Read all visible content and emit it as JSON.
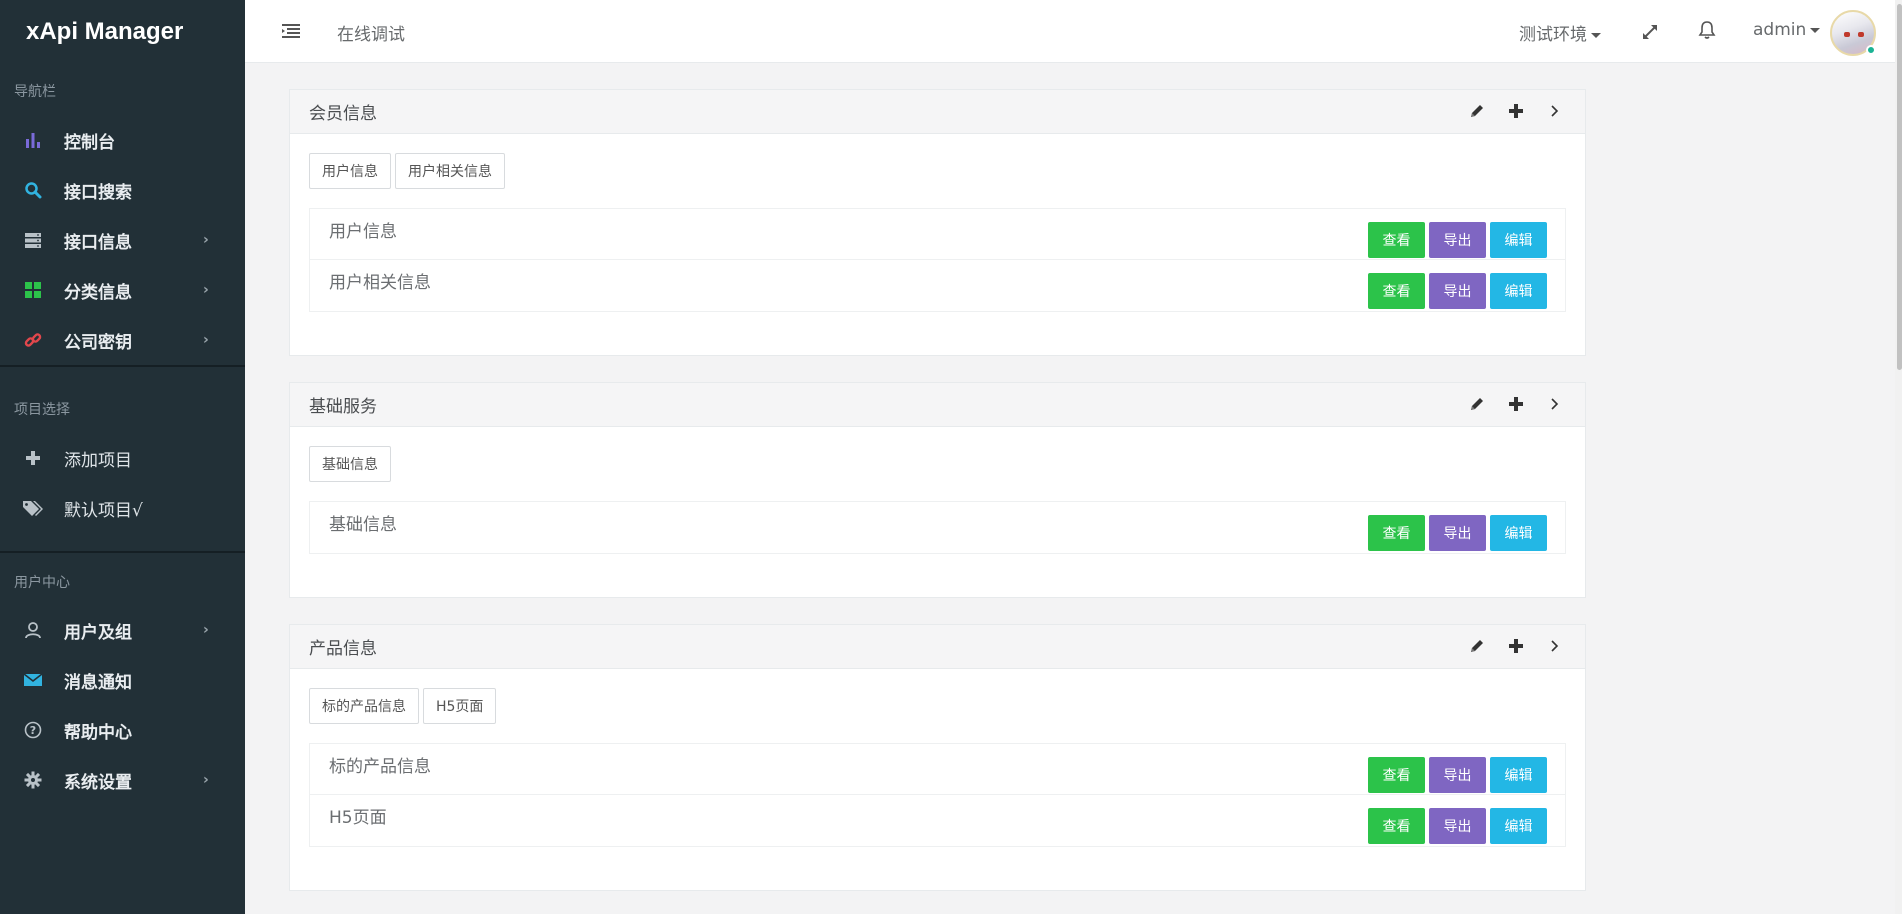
{
  "brand": "xApi Manager",
  "sidebar": {
    "section_nav": "导航栏",
    "nav": [
      {
        "label": "控制台",
        "icon": "bar-chart-icon",
        "arrow": false
      },
      {
        "label": "接口搜索",
        "icon": "search-icon",
        "arrow": false
      },
      {
        "label": "接口信息",
        "icon": "server-icon",
        "arrow": true
      },
      {
        "label": "分类信息",
        "icon": "grid-icon",
        "arrow": true
      },
      {
        "label": "公司密钥",
        "icon": "link-icon",
        "arrow": true
      }
    ],
    "section_project": "项目选择",
    "project": [
      {
        "label": "添加项目",
        "icon": "plus-icon"
      },
      {
        "label": "默认项目√",
        "icon": "tags-icon"
      }
    ],
    "section_user": "用户中心",
    "user": [
      {
        "label": "用户及组",
        "icon": "user-icon",
        "arrow": true
      },
      {
        "label": "消息通知",
        "icon": "envelope-icon",
        "arrow": false
      },
      {
        "label": "帮助中心",
        "icon": "question-icon",
        "arrow": false
      },
      {
        "label": "系统设置",
        "icon": "gear-icon",
        "arrow": true
      }
    ],
    "arrow_glyph": "›"
  },
  "topbar": {
    "breadcrumb": "在线调试",
    "env": "测试环境",
    "user": "admin"
  },
  "panels": [
    {
      "title": "会员信息",
      "tags": [
        "用户信息",
        "用户相关信息"
      ],
      "rows": [
        "用户信息",
        "用户相关信息"
      ]
    },
    {
      "title": "基础服务",
      "tags": [
        "基础信息"
      ],
      "rows": [
        "基础信息"
      ]
    },
    {
      "title": "产品信息",
      "tags": [
        "标的产品信息",
        "H5页面"
      ],
      "rows": [
        "标的产品信息",
        "H5页面"
      ]
    }
  ],
  "buttons": {
    "view": "查看",
    "export": "导出",
    "edit": "编辑"
  },
  "colors": {
    "sidebar_bg": "#223037",
    "view": "#2cc34a",
    "export": "#7f66c2",
    "edit": "#23b7e5"
  }
}
